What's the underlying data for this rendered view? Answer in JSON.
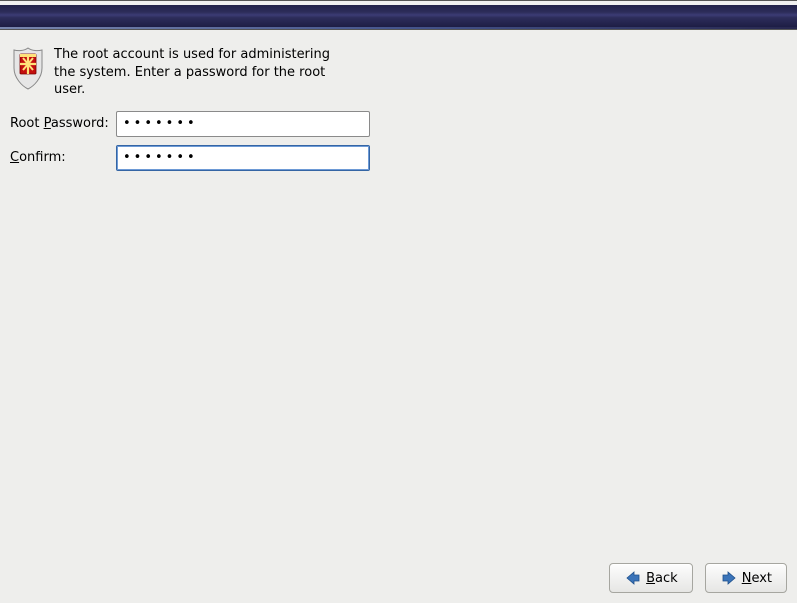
{
  "intro": {
    "text": "The root account is used for administering the system.  Enter a password for the root user."
  },
  "form": {
    "password_label_pre": "Root ",
    "password_label_ul": "P",
    "password_label_post": "assword:",
    "confirm_label_ul": "C",
    "confirm_label_post": "onfirm:",
    "password_value": "•••••••",
    "confirm_value": "•••••••"
  },
  "footer": {
    "back_ul": "B",
    "back_rest": "ack",
    "next_ul": "N",
    "next_rest": "ext"
  }
}
